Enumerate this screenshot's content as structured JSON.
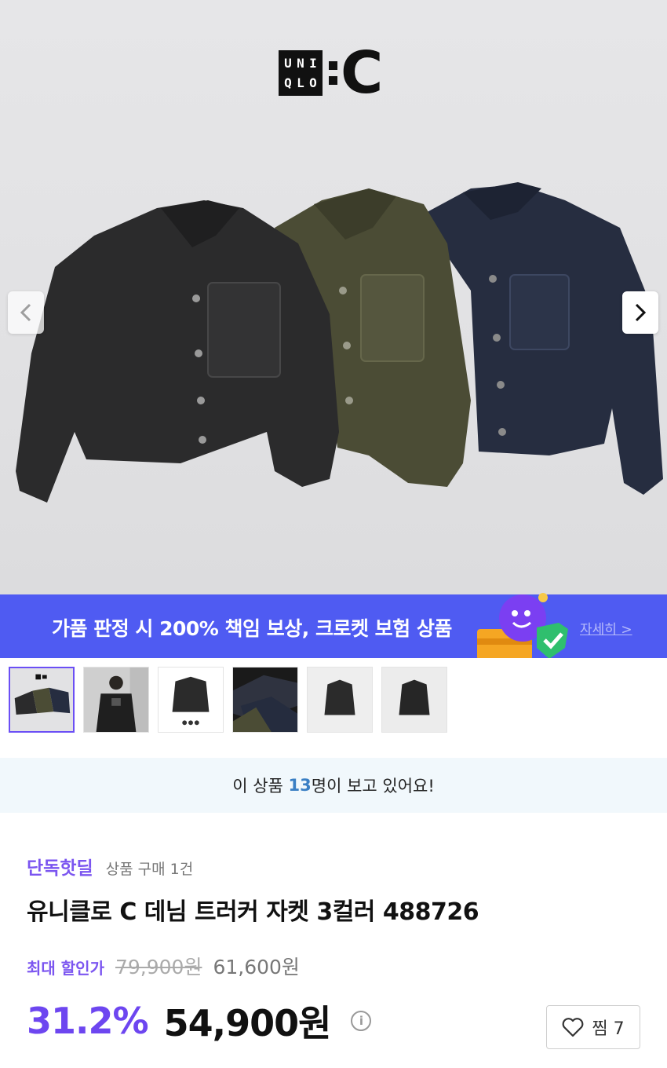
{
  "hero": {
    "brand_uq_letters": [
      "U",
      "N",
      "I",
      "Q",
      "L",
      "O"
    ],
    "brand_c": "C",
    "prev_arrow_icon": "chevron-left-icon",
    "next_arrow_icon": "chevron-right-icon",
    "jacket_colors": [
      "#2b2b2b",
      "#4a4b35",
      "#252c3e"
    ]
  },
  "banner": {
    "text": "가품 판정 시 200% 책임 보상, 크로켓 보험 상품",
    "more_link": "자세히 >",
    "bg_color": "#4f5bf2"
  },
  "thumbnails": {
    "count": 6,
    "active_index": 0,
    "active_border_color": "#6b4ff5"
  },
  "viewers": {
    "prefix": "이 상품 ",
    "count": "13",
    "suffix": "명이 보고 있어요!"
  },
  "product": {
    "deal_tag": "단독핫딜",
    "purchase_count": "상품 구매 1건",
    "title": "유니클로 C 데님 트러커 자켓 3컬러 488726",
    "max_discount_label": "최대 할인가",
    "original_price": "79,900원",
    "sub_price": "61,600원",
    "discount_rate": "31.2%",
    "final_price": "54,900원",
    "info_icon": "i"
  },
  "wishlist": {
    "label": "찜 7",
    "icon": "heart-icon"
  }
}
